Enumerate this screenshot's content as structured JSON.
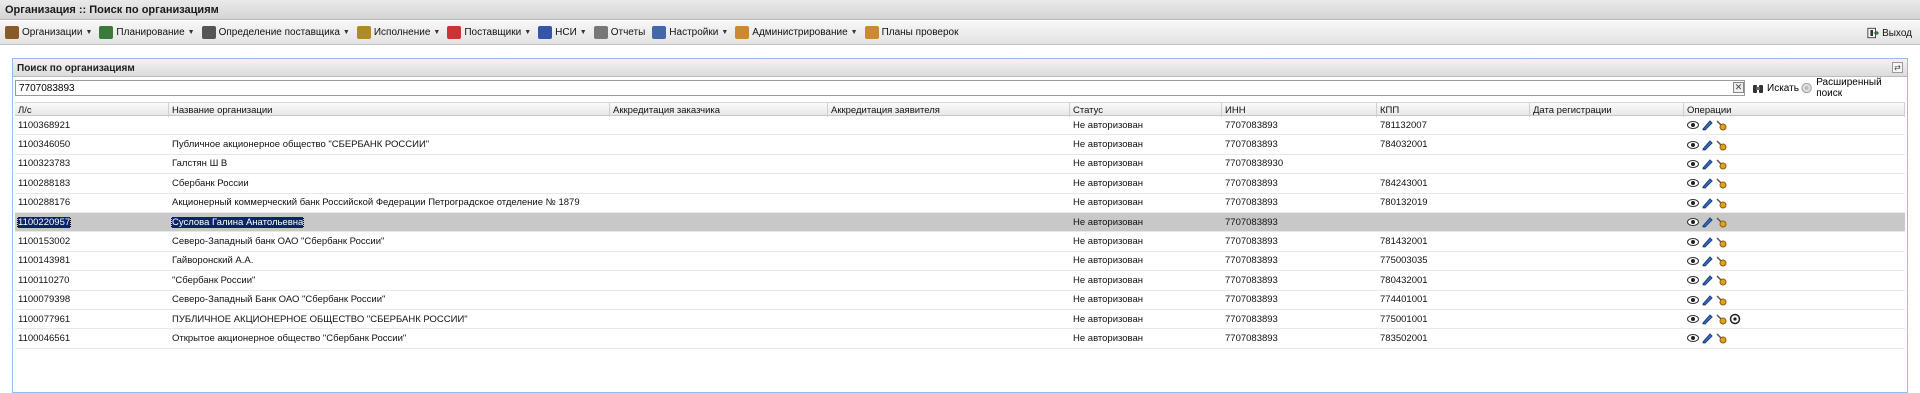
{
  "window": {
    "title": "Организация :: Поиск по организациям"
  },
  "menu": [
    {
      "label": "Организации",
      "icon": "building-icon",
      "color": "#8a5a2b"
    },
    {
      "label": "Планирование",
      "icon": "plan-icon",
      "color": "#3a7a3a"
    },
    {
      "label": "Определение поставщика",
      "icon": "gear-icon",
      "color": "#555555"
    },
    {
      "label": "Исполнение",
      "icon": "folder-icon",
      "color": "#b08a2a"
    },
    {
      "label": "Поставщики",
      "icon": "suppliers-icon",
      "color": "#cc3333"
    },
    {
      "label": "НСИ",
      "icon": "grid-icon",
      "color": "#3355aa"
    },
    {
      "label": "Отчеты",
      "icon": "report-icon",
      "color": "#777777"
    },
    {
      "label": "Настройки",
      "icon": "wrench-icon",
      "color": "#4466aa"
    },
    {
      "label": "Администрирование",
      "icon": "admin-user-icon",
      "color": "#cc8833"
    },
    {
      "label": "Планы проверок",
      "icon": "user-icon",
      "color": "#cc8833"
    }
  ],
  "exit": {
    "label": "Выход"
  },
  "panel": {
    "title": "Поиск по организациям"
  },
  "search": {
    "value": "7707083893",
    "search_label": "Искать",
    "advanced_label": "Расширенный поиск"
  },
  "grid": {
    "columns": [
      "Л/с",
      "Название организации",
      "Аккредитация заказчика",
      "Аккредитация заявителя",
      "Статус",
      "ИНН",
      "КПП",
      "Дата регистрации",
      "Операции"
    ],
    "rows": [
      {
        "ls": "1100368921",
        "name": "",
        "acc_customer": "",
        "acc_applicant": "",
        "status": "Не авторизован",
        "inn": "7707083893",
        "kpp": "781132007",
        "date": "",
        "extra_op": false
      },
      {
        "ls": "1100346050",
        "name": "Публичное акционерное общество \"СБЕРБАНК РОССИИ\"",
        "acc_customer": "",
        "acc_applicant": "",
        "status": "Не авторизован",
        "inn": "7707083893",
        "kpp": "784032001",
        "date": "",
        "extra_op": false
      },
      {
        "ls": "1100323783",
        "name": "Галстян Ш В",
        "acc_customer": "",
        "acc_applicant": "",
        "status": "Не авторизован",
        "inn": "77070838930",
        "kpp": "",
        "date": "",
        "extra_op": false
      },
      {
        "ls": "1100288183",
        "name": "Сбербанк России",
        "acc_customer": "",
        "acc_applicant": "",
        "status": "Не авторизован",
        "inn": "7707083893",
        "kpp": "784243001",
        "date": "",
        "extra_op": false
      },
      {
        "ls": "1100288176",
        "name": "Акционерный коммерческий банк Российской Федерации Петроградское отделение № 1879",
        "acc_customer": "",
        "acc_applicant": "",
        "status": "Не авторизован",
        "inn": "7707083893",
        "kpp": "780132019",
        "date": "",
        "extra_op": false
      },
      {
        "ls": "1100220957",
        "name": "Суслова Галина Анатольевна",
        "acc_customer": "",
        "acc_applicant": "",
        "status": "Не авторизован",
        "inn": "7707083893",
        "kpp": "",
        "date": "",
        "extra_op": false,
        "selected": true
      },
      {
        "ls": "1100153002",
        "name": "Северо-Западный банк ОАО \"Сбербанк России\"",
        "acc_customer": "",
        "acc_applicant": "",
        "status": "Не авторизован",
        "inn": "7707083893",
        "kpp": "781432001",
        "date": "",
        "extra_op": false
      },
      {
        "ls": "1100143981",
        "name": "Гайворонский А.А.",
        "acc_customer": "",
        "acc_applicant": "",
        "status": "Не авторизован",
        "inn": "7707083893",
        "kpp": "775003035",
        "date": "",
        "extra_op": false
      },
      {
        "ls": "1100110270",
        "name": "\"Сбербанк России\"",
        "acc_customer": "",
        "acc_applicant": "",
        "status": "Не авторизован",
        "inn": "7707083893",
        "kpp": "780432001",
        "date": "",
        "extra_op": false
      },
      {
        "ls": "1100079398",
        "name": "Северо-Западный Банк ОАО \"Сбербанк России\"",
        "acc_customer": "",
        "acc_applicant": "",
        "status": "Не авторизован",
        "inn": "7707083893",
        "kpp": "774401001",
        "date": "",
        "extra_op": false
      },
      {
        "ls": "1100077961",
        "name": "ПУБЛИЧНОЕ АКЦИОНЕРНОЕ ОБЩЕСТВО \"СБЕРБАНК РОССИИ\"",
        "acc_customer": "",
        "acc_applicant": "",
        "status": "Не авторизован",
        "inn": "7707083893",
        "kpp": "775001001",
        "date": "",
        "extra_op": true
      },
      {
        "ls": "1100046561",
        "name": "Открытое акционерное общество \"Сбербанк России\"",
        "acc_customer": "",
        "acc_applicant": "",
        "status": "Не авторизован",
        "inn": "7707083893",
        "kpp": "783502001",
        "date": "",
        "extra_op": false
      }
    ]
  }
}
